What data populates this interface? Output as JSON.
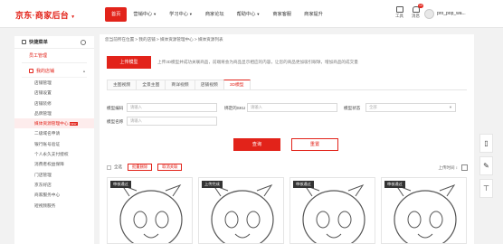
{
  "header": {
    "logo": "京东·商家后台",
    "nav": [
      {
        "label": "首页",
        "active": true,
        "caret": false
      },
      {
        "label": "营销中心",
        "active": false,
        "caret": true
      },
      {
        "label": "学习中心",
        "active": false,
        "caret": true
      },
      {
        "label": "商家论坛",
        "active": false,
        "caret": false
      },
      {
        "label": "帮助中心",
        "active": false,
        "caret": true
      },
      {
        "label": "商家客服",
        "active": false,
        "caret": false
      },
      {
        "label": "商家提升",
        "active": false,
        "caret": false
      }
    ],
    "tools_label": "工具",
    "messages_label": "消息",
    "messages_badge": "10",
    "username": "pro_pop_wa..."
  },
  "sidebar": {
    "title": "快捷菜单",
    "employee_center": "员工管理",
    "group": "我的店铺",
    "items": [
      {
        "label": "店铺管理",
        "active": false
      },
      {
        "label": "店铺设置",
        "active": false
      },
      {
        "label": "店铺装修",
        "active": false
      },
      {
        "label": "品牌管理",
        "active": false
      },
      {
        "label": "媒体资源管理中心",
        "active": true,
        "new": "NEW"
      },
      {
        "label": "二级域名申请",
        "active": false
      },
      {
        "label": "银行账号验证",
        "active": false
      },
      {
        "label": "个人永久支付授权",
        "active": false
      },
      {
        "label": "消费者权益保障",
        "active": false
      },
      {
        "label": "门店管理",
        "active": false
      },
      {
        "label": "京东好店",
        "active": false
      },
      {
        "label": "商家服务中心",
        "active": false
      },
      {
        "label": "短视频服务",
        "active": false
      }
    ]
  },
  "main": {
    "breadcrumb": "您当前所在位置 > 我的店铺 > 媒体资源管理中心 > 媒体资源列表",
    "upload_button": "上传模型",
    "upload_tip": "上传3D模型并成功关联商品，前端将会为商品显示相应的内容，让您的商品更加吸引眼球，增加商品的成交量",
    "tabs": [
      {
        "label": "主图视频",
        "active": false
      },
      {
        "label": "全景主图",
        "active": false
      },
      {
        "label": "商详视频",
        "active": false
      },
      {
        "label": "店铺视频",
        "active": false
      },
      {
        "label": "3D模型",
        "active": true
      }
    ],
    "filters": {
      "model_code_label": "模型编码",
      "model_code_placeholder": "请输入",
      "sku_label": "绑定的SKU",
      "sku_placeholder": "请输入",
      "status_label": "模型状态",
      "status_value": "全部",
      "name_label": "模型名称",
      "name_placeholder": "请输入"
    },
    "query_button": "查询",
    "reset_button": "重置",
    "select_all": "全选",
    "batch_delete": "批量删除",
    "cancel_bind": "取消关联",
    "sort_label": "上传时间",
    "cards": [
      {
        "tag": "审核通过"
      },
      {
        "tag": "上传完成"
      },
      {
        "tag": "审核通过"
      },
      {
        "tag": "审核通过"
      }
    ]
  },
  "colors": {
    "accent": "#e2231a"
  }
}
